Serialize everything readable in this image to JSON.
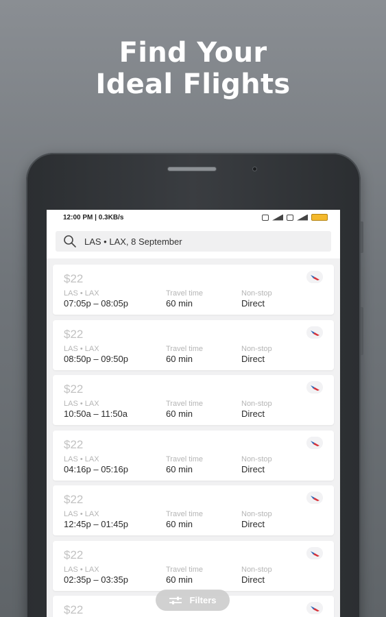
{
  "hero": {
    "line1": "Find Your",
    "line2": "Ideal Flights"
  },
  "status_bar": {
    "time_speed": "12:00 PM | 0.3KB/s"
  },
  "search": {
    "query": "LAS • LAX, 8 September"
  },
  "labels": {
    "travel_time": "Travel time",
    "stops": "Non-stop"
  },
  "flights": [
    {
      "price": "$22",
      "route": "LAS • LAX",
      "times": "07:05p – 08:05p",
      "duration": "60 min",
      "stops": "Direct"
    },
    {
      "price": "$22",
      "route": "LAS • LAX",
      "times": "08:50p – 09:50p",
      "duration": "60 min",
      "stops": "Direct"
    },
    {
      "price": "$22",
      "route": "LAS • LAX",
      "times": "10:50a – 11:50a",
      "duration": "60 min",
      "stops": "Direct"
    },
    {
      "price": "$22",
      "route": "LAS • LAX",
      "times": "04:16p – 05:16p",
      "duration": "60 min",
      "stops": "Direct"
    },
    {
      "price": "$22",
      "route": "LAS • LAX",
      "times": "12:45p – 01:45p",
      "duration": "60 min",
      "stops": "Direct"
    },
    {
      "price": "$22",
      "route": "LAS • LAX",
      "times": "02:35p – 03:35p",
      "duration": "60 min",
      "stops": "Direct"
    },
    {
      "price": "$22"
    }
  ],
  "filters": {
    "label": "Filters"
  },
  "colors": {
    "background": "#70757a",
    "airline_red": "#d6313a",
    "airline_blue": "#2b64b6",
    "battery": "#f4b92d"
  },
  "icons": {
    "search": "search-icon",
    "airline": "airline-logo-icon",
    "filters": "sliders-icon"
  }
}
